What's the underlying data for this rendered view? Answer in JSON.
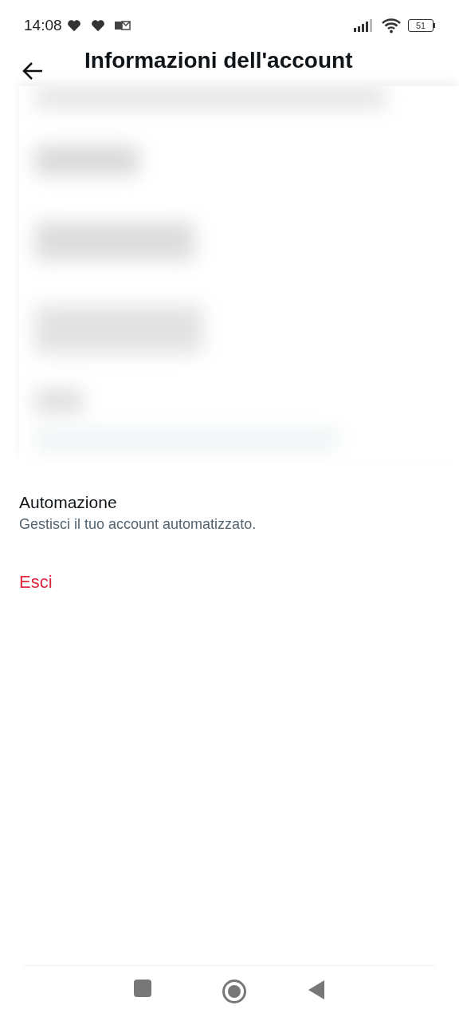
{
  "status_bar": {
    "time": "14:08",
    "battery": "51"
  },
  "header": {
    "title": "Informazioni dell'account"
  },
  "items": [
    {
      "kind": "setting",
      "title": "Automazione",
      "subtitle": "Gestisci il tuo account automatizzato."
    },
    {
      "kind": "danger",
      "title": "Esci"
    }
  ]
}
